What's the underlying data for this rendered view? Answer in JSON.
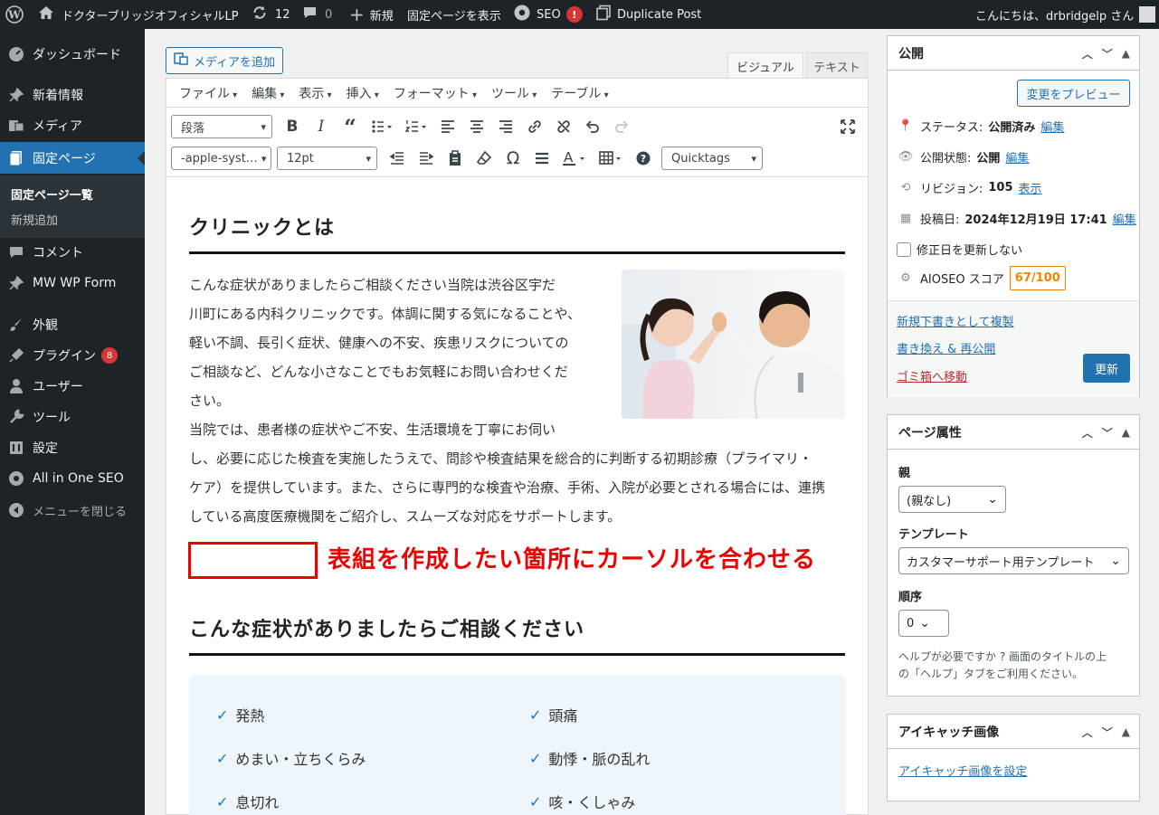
{
  "adminbar": {
    "site_name": "ドクターブリッジオフィシャルLP",
    "updates": "12",
    "comments": "0",
    "new_label": "新規",
    "view_label": "固定ページを表示",
    "seo_label": "SEO",
    "seo_alert": "!",
    "duplicate_label": "Duplicate Post",
    "greeting": "こんにちは、drbridgelp さん"
  },
  "sidebar": {
    "items": [
      {
        "label": "ダッシュボード",
        "icon": "dashboard-icon"
      },
      {
        "label": "新着情報",
        "icon": "pin-icon"
      },
      {
        "label": "メディア",
        "icon": "media-icon"
      },
      {
        "label": "固定ページ",
        "icon": "page-icon"
      },
      {
        "label": "コメント",
        "icon": "comment-icon"
      },
      {
        "label": "MW WP Form",
        "icon": "pin-icon"
      },
      {
        "label": "外観",
        "icon": "brush-icon"
      },
      {
        "label": "プラグイン",
        "icon": "plugin-icon",
        "badge": "8"
      },
      {
        "label": "ユーザー",
        "icon": "user-icon"
      },
      {
        "label": "ツール",
        "icon": "wrench-icon"
      },
      {
        "label": "設定",
        "icon": "settings-icon"
      },
      {
        "label": "All in One SEO",
        "icon": "aioseo-icon"
      },
      {
        "label": "メニューを閉じる",
        "icon": "collapse-icon"
      }
    ],
    "submenu": [
      "固定ページ一覧",
      "新規追加"
    ]
  },
  "editor": {
    "add_media": "メディアを追加",
    "tab_visual": "ビジュアル",
    "tab_text": "テキスト",
    "menus": [
      "ファイル",
      "編集",
      "表示",
      "挿入",
      "フォーマット",
      "ツール",
      "テーブル"
    ],
    "format_select": "段落",
    "font_select": "-apple-syst…",
    "size_select": "12pt",
    "quicktags_select": "Quicktags"
  },
  "content": {
    "h1": "クリニックとは",
    "p_wrap": [
      "こんな症状がありましたらご相談ください当院は渋谷区宇だ",
      "川町にある内科クリニックです。体調に関する気になることや、",
      "軽い不調、長引く症状、健康への不安、疾患リスクについての",
      "ご相談など、どんな小さなことでもお気軽にお問い合わせくだ",
      "さい。",
      "当院では、患者様の症状やご不安、生活環境を丁寧にお伺い"
    ],
    "p_full": [
      "し、必要に応じた検査を実施したうえで、問診や検査結果を総合的に判断する初期診療（プライマリ・",
      "ケア）を提供しています。また、さらに専門的な検査や治療、手術、入院が必要とされる場合には、連携",
      "している高度医療機関をご紹介し、スムーズな対応をサポートします。"
    ],
    "annotation": "表組を作成したい箇所にカーソルを合わせる",
    "h2": "こんな症状がありましたらご相談ください",
    "symptoms": [
      "発熱",
      "頭痛",
      "めまい・立ちくらみ",
      "動悸・脈の乱れ",
      "息切れ",
      "咳・くしゃみ"
    ]
  },
  "publish": {
    "title": "公開",
    "preview": "変更をプレビュー",
    "status_label": "ステータス:",
    "status_value": "公開済み",
    "visibility_label": "公開状態:",
    "visibility_value": "公開",
    "revision_label": "リビジョン:",
    "revision_value": "105",
    "revision_link": "表示",
    "date_label": "投稿日:",
    "date_value": "2024年12月19日 17:41",
    "edit": "編集",
    "no_update_date": "修正日を更新しない",
    "aioseo_label": "AIOSEO スコア",
    "aioseo_score": "67/100",
    "copy_draft": "新規下書きとして複製",
    "rewrite": "書き換え & 再公開",
    "trash": "ゴミ箱へ移動",
    "update": "更新"
  },
  "attributes": {
    "title": "ページ属性",
    "parent_label": "親",
    "parent_value": "(親なし)",
    "template_label": "テンプレート",
    "template_value": "カスタマーサポート用テンプレート",
    "order_label": "順序",
    "order_value": "0",
    "help": [
      "ヘルプが必要ですか ? 画面のタイトルの上",
      "の「ヘルプ」タブをご利用ください。"
    ]
  },
  "featured": {
    "title": "アイキャッチ画像",
    "set_link": "アイキャッチ画像を設定"
  },
  "colors": {
    "accent": "#2271b1",
    "annotation": "#e00000",
    "aioseo_score": "#f18200",
    "sidebar_bg": "#1d2327"
  }
}
